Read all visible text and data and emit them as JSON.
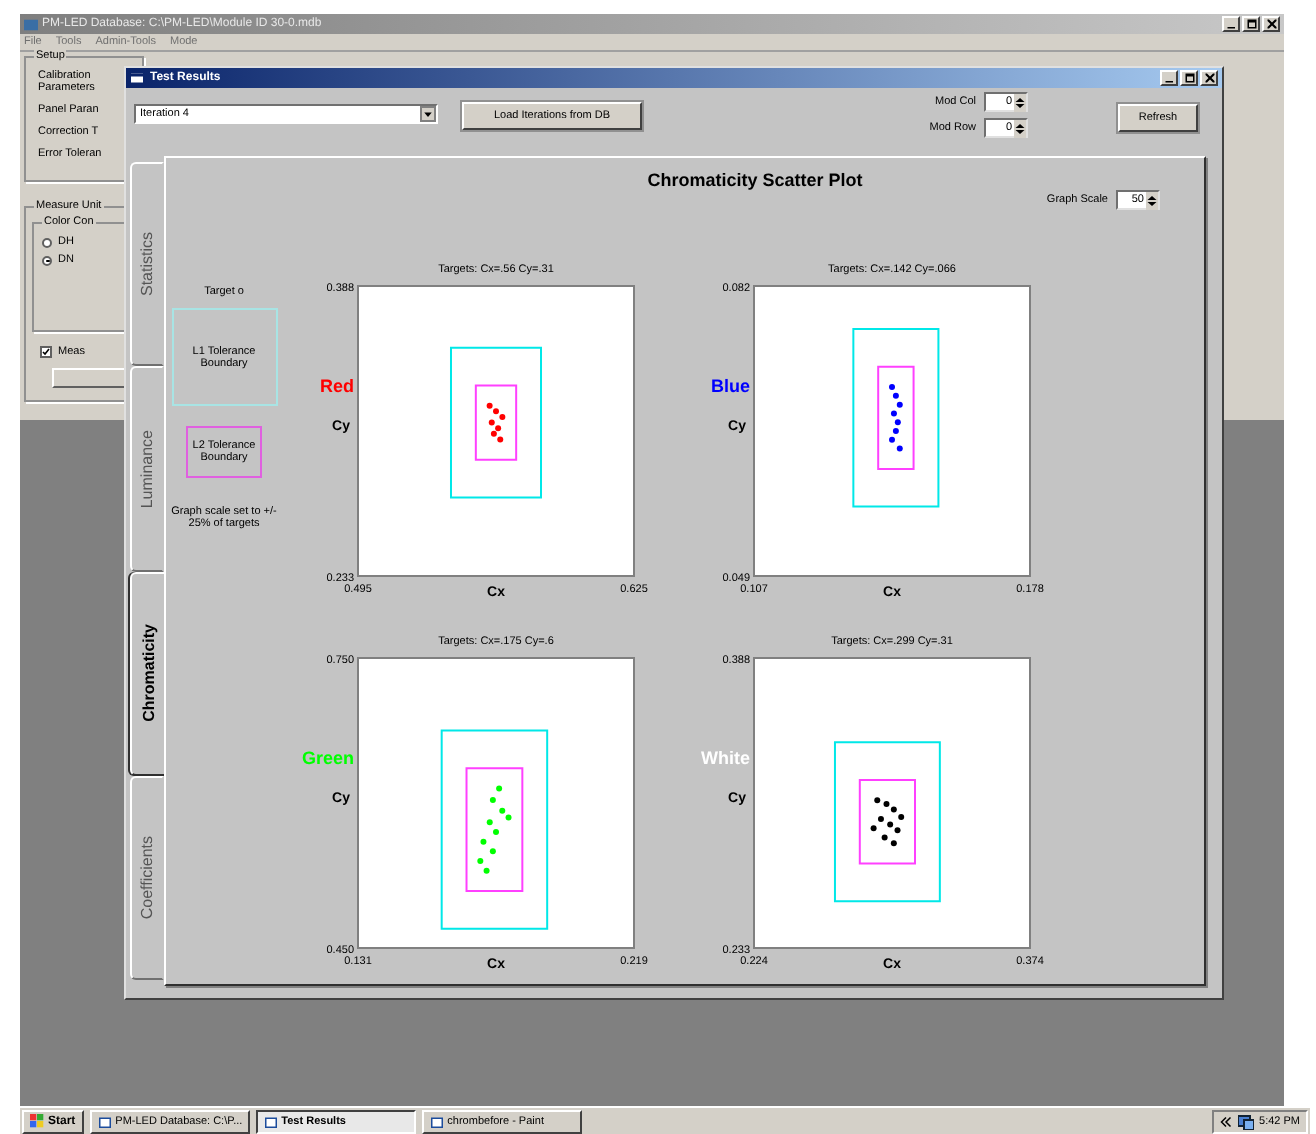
{
  "main_window": {
    "title": "PM-LED Database: C:\\PM-LED\\Module ID 30-0.mdb",
    "menu": [
      "File",
      "Tools",
      "Admin-Tools",
      "Mode"
    ],
    "setup": {
      "title": "Setup",
      "buttons": [
        "Calibration Parameters",
        "Panel Paran",
        "Correction T",
        "Error Toleran"
      ]
    },
    "measure_units": {
      "title": "Measure Unit",
      "color_group": {
        "title": "Color Con",
        "options": [
          {
            "label": "DH",
            "selected": false
          },
          {
            "label": "DN",
            "selected": true
          }
        ]
      },
      "checkbox": {
        "label": "Meas",
        "checked": true
      }
    }
  },
  "test_results": {
    "title": "Test Results",
    "iteration": {
      "value": "Iteration 4"
    },
    "load_button": "Load Iterations from DB",
    "mod_col": {
      "label": "Mod Col",
      "value": "0"
    },
    "mod_row": {
      "label": "Mod Row",
      "value": "0"
    },
    "refresh_button": "Refresh",
    "tabs": [
      {
        "label": "Statistics",
        "selected": false
      },
      {
        "label": "Luminance",
        "selected": false
      },
      {
        "label": "Chromaticity",
        "selected": true
      },
      {
        "label": "Coefficients",
        "selected": false
      }
    ],
    "panel": {
      "title": "Chromaticity Scatter Plot",
      "graph_scale": {
        "label": "Graph Scale",
        "value": "50"
      },
      "legend": {
        "target": "Target o",
        "l1": "L1 Tolerance Boundary",
        "l2": "L2 Tolerance Boundary",
        "note": "Graph scale set to +/- 25% of targets"
      },
      "plots": [
        {
          "color": "#ff0000",
          "chart_data": {
            "type": "scatter",
            "title": "Targets:  Cx=.56   Cy=.31",
            "xlabel": "Cx",
            "ylabel": "Cy",
            "xlim": [
              0.495,
              0.625
            ],
            "ylim": [
              0.233,
              0.388
            ],
            "xticks": [
              {
                "value": 0.495,
                "label": "0.495"
              },
              {
                "value": 0.625,
                "label": "0.625"
              }
            ],
            "yticks": [
              {
                "value": 0.233,
                "label": "0.233"
              },
              {
                "value": 0.388,
                "label": "0.388"
              }
            ],
            "series": [
              {
                "name": "Red",
                "color": "#ff0000",
                "x": [
                  0.557,
                  0.56,
                  0.563,
                  0.558,
                  0.561,
                  0.559,
                  0.562
                ],
                "values": [
                  0.324,
                  0.321,
                  0.318,
                  0.315,
                  0.312,
                  0.309,
                  0.306
                ]
              }
            ]
          }
        },
        {
          "color": "#0000ff",
          "chart_data": {
            "type": "scatter",
            "title": "Targets:  Cx=.142   Cy=.066",
            "xlabel": "Cx",
            "ylabel": "Cy",
            "xlim": [
              0.107,
              0.178
            ],
            "ylim": [
              0.049,
              0.082
            ],
            "xticks": [
              {
                "value": 0.107,
                "label": "0.107"
              },
              {
                "value": 0.178,
                "label": "0.178"
              }
            ],
            "yticks": [
              {
                "value": 0.049,
                "label": "0.049"
              },
              {
                "value": 0.082,
                "label": "0.082"
              }
            ],
            "series": [
              {
                "name": "Blue",
                "color": "#0000ff",
                "x": [
                  0.1425,
                  0.1435,
                  0.1445,
                  0.143,
                  0.144,
                  0.1435,
                  0.1425,
                  0.1445
                ],
                "values": [
                  0.0705,
                  0.0695,
                  0.0685,
                  0.0675,
                  0.0665,
                  0.0655,
                  0.0645,
                  0.0635
                ]
              }
            ]
          }
        },
        {
          "color": "#00ff00",
          "chart_data": {
            "type": "scatter",
            "title": "Targets:  Cx=.175   Cy=.6",
            "xlabel": "Cx",
            "ylabel": "Cy",
            "xlim": [
              0.131,
              0.219
            ],
            "ylim": [
              0.45,
              0.75
            ],
            "xticks": [
              {
                "value": 0.131,
                "label": "0.131"
              },
              {
                "value": 0.219,
                "label": "0.219"
              }
            ],
            "yticks": [
              {
                "value": 0.45,
                "label": "0.450"
              },
              {
                "value": 0.75,
                "label": "0.750"
              }
            ],
            "series": [
              {
                "name": "Green",
                "color": "#00ff00",
                "x": [
                  0.176,
                  0.174,
                  0.177,
                  0.173,
                  0.175,
                  0.171,
                  0.174,
                  0.17,
                  0.172,
                  0.179
                ],
                "values": [
                  0.615,
                  0.603,
                  0.592,
                  0.58,
                  0.57,
                  0.56,
                  0.55,
                  0.54,
                  0.53,
                  0.585
                ]
              }
            ]
          }
        },
        {
          "color": "#ffffff",
          "chart_data": {
            "type": "scatter",
            "title": "Targets:  Cx=.299   Cy=.31",
            "xlabel": "Cx",
            "ylabel": "Cy",
            "xlim": [
              0.224,
              0.374
            ],
            "ylim": [
              0.233,
              0.388
            ],
            "xticks": [
              {
                "value": 0.224,
                "label": "0.224"
              },
              {
                "value": 0.374,
                "label": "0.374"
              }
            ],
            "yticks": [
              {
                "value": 0.233,
                "label": "0.233"
              },
              {
                "value": 0.388,
                "label": "0.388"
              }
            ],
            "series": [
              {
                "name": "White",
                "color": "#000000",
                "x": [
                  0.291,
                  0.296,
                  0.3,
                  0.304,
                  0.293,
                  0.298,
                  0.302,
                  0.289,
                  0.295,
                  0.3
                ],
                "values": [
                  0.312,
                  0.31,
                  0.307,
                  0.303,
                  0.302,
                  0.299,
                  0.296,
                  0.297,
                  0.292,
                  0.289
                ]
              }
            ]
          }
        }
      ]
    }
  },
  "taskbar": {
    "start": "Start",
    "tasks": [
      {
        "label": "PM-LED Database: C:\\P...",
        "selected": false
      },
      {
        "label": "Test Results",
        "selected": true
      },
      {
        "label": "chrombefore - Paint",
        "selected": false
      }
    ],
    "clock": "5:42 PM"
  }
}
